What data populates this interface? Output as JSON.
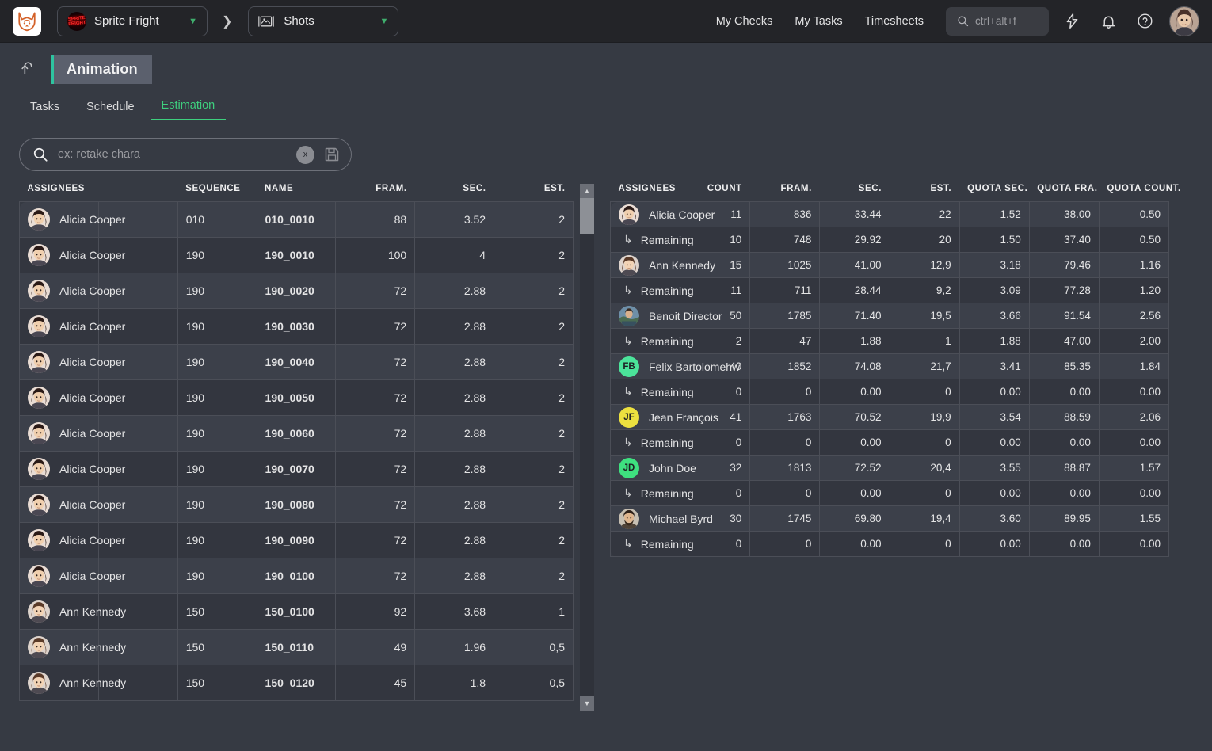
{
  "topbar": {
    "project_label": "Sprite Fright",
    "entity_label": "Shots",
    "nav": [
      {
        "label": "My Checks"
      },
      {
        "label": "My Tasks"
      },
      {
        "label": "Timesheets"
      }
    ],
    "search_placeholder": "ctrl+alt+f",
    "icons": {
      "search": "search-icon",
      "bolt": "bolt-icon",
      "bell": "bell-icon",
      "help": "help-icon",
      "avatar": "user-avatar"
    }
  },
  "page": {
    "title": "Animation",
    "accent_color": "#2ec4a0"
  },
  "tabs": [
    {
      "label": "Tasks",
      "active": false
    },
    {
      "label": "Schedule",
      "active": false
    },
    {
      "label": "Estimation",
      "active": true
    }
  ],
  "filter": {
    "placeholder": "ex: retake chara",
    "value": "",
    "clear_label": "x"
  },
  "left_table": {
    "columns": [
      "ASSIGNEES",
      "",
      "SEQUENCE",
      "NAME",
      "FRAM.",
      "SEC.",
      "EST."
    ],
    "rows": [
      {
        "assignee": "Alicia Cooper",
        "avatar": "alicia",
        "thumb": "jungle",
        "sequence": "010",
        "name": "010_0010",
        "fram": "88",
        "sec": "3.52",
        "est": "2"
      },
      {
        "assignee": "Alicia Cooper",
        "avatar": "alicia",
        "thumb": "neon",
        "sequence": "190",
        "name": "190_0010",
        "fram": "100",
        "sec": "4",
        "est": "2"
      },
      {
        "assignee": "Alicia Cooper",
        "avatar": "alicia",
        "thumb": "branch",
        "sequence": "190",
        "name": "190_0020",
        "fram": "72",
        "sec": "2.88",
        "est": "2"
      },
      {
        "assignee": "Alicia Cooper",
        "avatar": "alicia",
        "thumb": "grey",
        "sequence": "190",
        "name": "190_0030",
        "fram": "72",
        "sec": "2.88",
        "est": "2"
      },
      {
        "assignee": "Alicia Cooper",
        "avatar": "alicia",
        "thumb": "flowers",
        "sequence": "190",
        "name": "190_0040",
        "fram": "72",
        "sec": "2.88",
        "est": "2"
      },
      {
        "assignee": "Alicia Cooper",
        "avatar": "alicia",
        "thumb": "room",
        "sequence": "190",
        "name": "190_0050",
        "fram": "72",
        "sec": "2.88",
        "est": "2"
      },
      {
        "assignee": "Alicia Cooper",
        "avatar": "alicia",
        "thumb": "dark",
        "sequence": "190",
        "name": "190_0060",
        "fram": "72",
        "sec": "2.88",
        "est": "2"
      },
      {
        "assignee": "Alicia Cooper",
        "avatar": "alicia",
        "thumb": "pink",
        "sequence": "190",
        "name": "190_0070",
        "fram": "72",
        "sec": "2.88",
        "est": "2"
      },
      {
        "assignee": "Alicia Cooper",
        "avatar": "alicia",
        "thumb": "table",
        "sequence": "190",
        "name": "190_0080",
        "fram": "72",
        "sec": "2.88",
        "est": "2"
      },
      {
        "assignee": "Alicia Cooper",
        "avatar": "alicia",
        "thumb": "red",
        "sequence": "190",
        "name": "190_0090",
        "fram": "72",
        "sec": "2.88",
        "est": "2"
      },
      {
        "assignee": "Alicia Cooper",
        "avatar": "alicia",
        "thumb": "cake",
        "sequence": "190",
        "name": "190_0100",
        "fram": "72",
        "sec": "2.88",
        "est": "2"
      },
      {
        "assignee": "Ann Kennedy",
        "avatar": "ann",
        "thumb": "night1",
        "sequence": "150",
        "name": "150_0100",
        "fram": "92",
        "sec": "3.68",
        "est": "1"
      },
      {
        "assignee": "Ann Kennedy",
        "avatar": "ann",
        "thumb": "night2",
        "sequence": "150",
        "name": "150_0110",
        "fram": "49",
        "sec": "1.96",
        "est": "0,5"
      },
      {
        "assignee": "Ann Kennedy",
        "avatar": "ann",
        "thumb": "night3",
        "sequence": "150",
        "name": "150_0120",
        "fram": "45",
        "sec": "1.8",
        "est": "0,5"
      }
    ]
  },
  "right_table": {
    "columns": [
      "ASSIGNEES",
      "COUNT",
      "FRAM.",
      "SEC.",
      "EST.",
      "QUOTA SEC.",
      "QUOTA FRA.",
      "QUOTA COUNT."
    ],
    "remaining_label": "Remaining",
    "rows": [
      {
        "assignee": "Alicia Cooper",
        "avatar": "alicia",
        "type": "person",
        "count": "11",
        "fram": "836",
        "sec": "33.44",
        "est": "22",
        "qsec": "1.52",
        "qfra": "38.00",
        "qcount": "0.50"
      },
      {
        "assignee": "Remaining",
        "type": "remaining",
        "count": "10",
        "fram": "748",
        "sec": "29.92",
        "est": "20",
        "qsec": "1.50",
        "qfra": "37.40",
        "qcount": "0.50"
      },
      {
        "assignee": "Ann Kennedy",
        "avatar": "ann",
        "type": "person",
        "count": "15",
        "fram": "1025",
        "sec": "41.00",
        "est": "12,9",
        "qsec": "3.18",
        "qfra": "79.46",
        "qcount": "1.16"
      },
      {
        "assignee": "Remaining",
        "type": "remaining",
        "count": "11",
        "fram": "711",
        "sec": "28.44",
        "est": "9,2",
        "qsec": "3.09",
        "qfra": "77.28",
        "qcount": "1.20"
      },
      {
        "assignee": "Benoit Director",
        "avatar": "benoit",
        "type": "person",
        "count": "50",
        "fram": "1785",
        "sec": "71.40",
        "est": "19,5",
        "qsec": "3.66",
        "qfra": "91.54",
        "qcount": "2.56"
      },
      {
        "assignee": "Remaining",
        "type": "remaining",
        "count": "2",
        "fram": "47",
        "sec": "1.88",
        "est": "1",
        "qsec": "1.88",
        "qfra": "47.00",
        "qcount": "2.00"
      },
      {
        "assignee": "Felix Bartolomehw",
        "avatar": "FB",
        "avatar_color": "#4be39a",
        "type": "person",
        "count": "40",
        "fram": "1852",
        "sec": "74.08",
        "est": "21,7",
        "qsec": "3.41",
        "qfra": "85.35",
        "qcount": "1.84"
      },
      {
        "assignee": "Remaining",
        "type": "remaining",
        "count": "0",
        "fram": "0",
        "sec": "0.00",
        "est": "0",
        "qsec": "0.00",
        "qfra": "0.00",
        "qcount": "0.00"
      },
      {
        "assignee": "Jean François",
        "avatar": "JF",
        "avatar_color": "#ece03f",
        "type": "person",
        "count": "41",
        "fram": "1763",
        "sec": "70.52",
        "est": "19,9",
        "qsec": "3.54",
        "qfra": "88.59",
        "qcount": "2.06"
      },
      {
        "assignee": "Remaining",
        "type": "remaining",
        "count": "0",
        "fram": "0",
        "sec": "0.00",
        "est": "0",
        "qsec": "0.00",
        "qfra": "0.00",
        "qcount": "0.00"
      },
      {
        "assignee": "John Doe",
        "avatar": "JD",
        "avatar_color": "#3ee07f",
        "type": "person",
        "count": "32",
        "fram": "1813",
        "sec": "72.52",
        "est": "20,4",
        "qsec": "3.55",
        "qfra": "88.87",
        "qcount": "1.57"
      },
      {
        "assignee": "Remaining",
        "type": "remaining",
        "count": "0",
        "fram": "0",
        "sec": "0.00",
        "est": "0",
        "qsec": "0.00",
        "qfra": "0.00",
        "qcount": "0.00"
      },
      {
        "assignee": "Michael Byrd",
        "avatar": "michael",
        "type": "person",
        "count": "30",
        "fram": "1745",
        "sec": "69.80",
        "est": "19,4",
        "qsec": "3.60",
        "qfra": "89.95",
        "qcount": "1.55"
      },
      {
        "assignee": "Remaining",
        "type": "remaining",
        "count": "0",
        "fram": "0",
        "sec": "0.00",
        "est": "0",
        "qsec": "0.00",
        "qfra": "0.00",
        "qcount": "0.00"
      }
    ]
  }
}
